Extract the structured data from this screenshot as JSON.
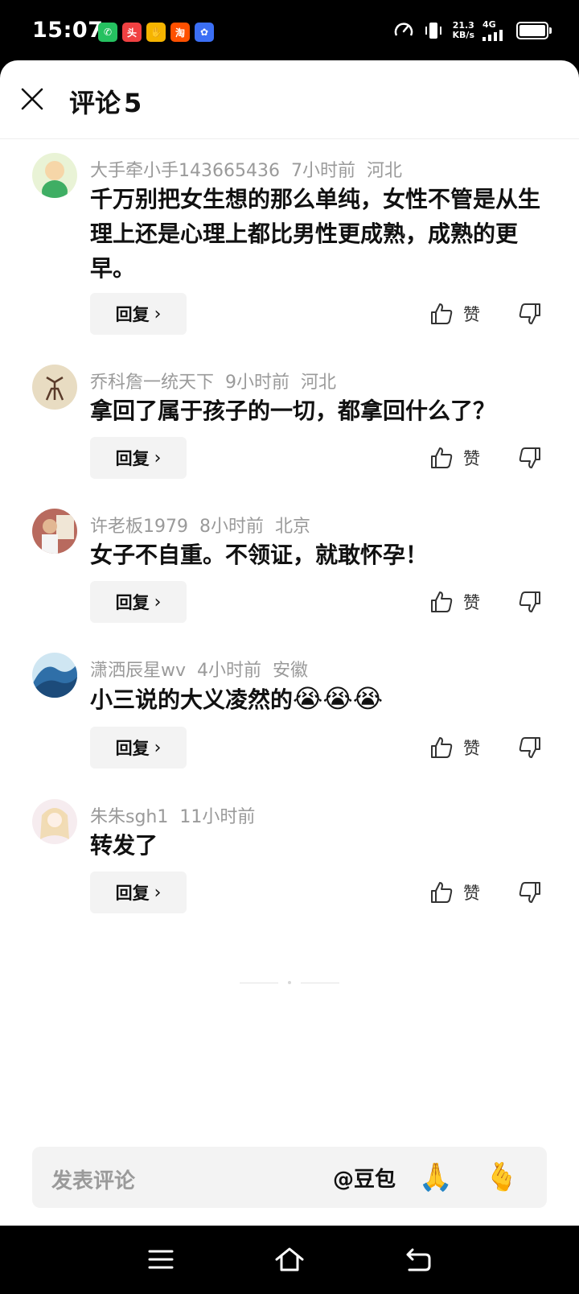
{
  "status_bar": {
    "time": "15:07",
    "apps": [
      {
        "icon": "wechat-icon",
        "glyph": "✆",
        "color": "#25c160"
      },
      {
        "icon": "toutiao-icon",
        "glyph": "头",
        "color": "#f04142"
      },
      {
        "icon": "hand-app-icon",
        "glyph": "✋",
        "color": "#f5b400"
      },
      {
        "icon": "taobao-icon",
        "glyph": "淘",
        "color": "#ff5000"
      },
      {
        "icon": "baidu-icon",
        "glyph": "✿",
        "color": "#3b6ff5"
      }
    ],
    "speed_value": "21.3",
    "speed_unit": "KB/s",
    "network": "4G"
  },
  "header": {
    "title": "评论",
    "count": "5"
  },
  "comments": [
    {
      "author": "大手牵小手143665436",
      "time": "7小时前",
      "location": "河北",
      "text": "千万别把女生想的那么单纯，女性不管是从生理上还是心理上都比男性更成熟，成熟的更早。",
      "avatar_color": "#7fc48a"
    },
    {
      "author": "乔科詹一统天下",
      "time": "9小时前",
      "location": "河北",
      "text": "拿回了属于孩子的一切，都拿回什么了？",
      "avatar_color": "#e8dcc2"
    },
    {
      "author": "许老板1979",
      "time": "8小时前",
      "location": "北京",
      "text": "女子不自重。不领证，就敢怀孕！",
      "avatar_color": "#b86a5e"
    },
    {
      "author": "潇洒辰星wv",
      "time": "4小时前",
      "location": "安徽",
      "text": "小三说的大义凌然的",
      "emoji": "😭😭😭",
      "avatar_color": "#2f6fa8"
    },
    {
      "author": "朱朱sgh1",
      "time": "11小时前",
      "location": "",
      "text": "转发了",
      "avatar_color": "#f3e3e3"
    }
  ],
  "actions": {
    "reply_label": "回复",
    "reply_chevron": "›",
    "like_label": "赞"
  },
  "input": {
    "placeholder": "发表评论",
    "mention": "@豆包",
    "emoji_1": "🙏",
    "emoji_2": "🫰"
  }
}
